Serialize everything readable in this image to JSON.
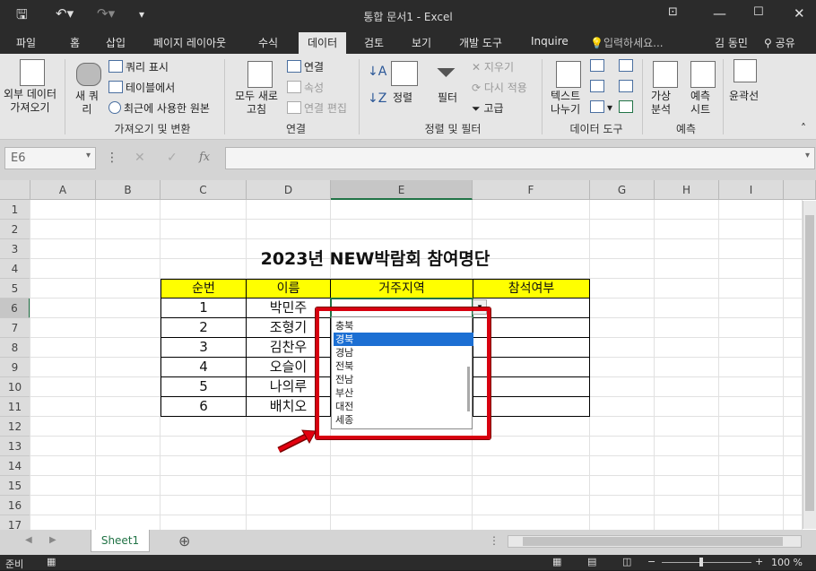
{
  "window": {
    "title": "통합 문서1 - Excel",
    "qat_icons": [
      "save-icon",
      "undo-icon",
      "redo-icon",
      "customize-icon"
    ],
    "controls": [
      "ribbon-display-icon",
      "minimize-icon",
      "maximize-icon",
      "close-icon"
    ]
  },
  "tabs": [
    "파일",
    "홈",
    "삽입",
    "페이지 레이아웃",
    "수식",
    "데이터",
    "검토",
    "보기",
    "개발 도구",
    "Inquire"
  ],
  "active_tab": "데이터",
  "tell_me": "입력하세요...",
  "user": "김 동민",
  "share": "공유",
  "ribbon": {
    "external_data": "외부 데이터\n가져오기",
    "new_query": "새 쿼\n리",
    "show_query": "쿼리 표시",
    "from_table": "테이블에서",
    "recent_sources": "최근에 사용한 원본",
    "refresh_all": "모두 새로\n고침",
    "connections": "연결",
    "properties": "속성",
    "edit_links": "연결 편집",
    "sort": "정렬",
    "filter": "필터",
    "clear": "지우기",
    "reapply": "다시 적용",
    "advanced": "고급",
    "text_to_columns": "텍스트\n나누기",
    "what_if": "가상\n분석",
    "forecast_sheet": "예측\n시트",
    "outline": "윤곽선",
    "groups": {
      "get_transform": "가져오기 및 변환",
      "connections": "연결",
      "sort_filter": "정렬 및 필터",
      "data_tools": "데이터 도구",
      "forecast": "예측"
    }
  },
  "formula_bar": {
    "name_box": "E6",
    "fx": "fx",
    "value": ""
  },
  "columns": [
    "A",
    "B",
    "C",
    "D",
    "E",
    "F",
    "G",
    "H",
    "I"
  ],
  "rows": [
    "1",
    "2",
    "3",
    "4",
    "5",
    "6",
    "7",
    "8",
    "9",
    "10",
    "11",
    "12",
    "13",
    "14",
    "15",
    "16",
    "17"
  ],
  "sheet": {
    "title": "2023년 NEW박람회 참여명단",
    "headers": [
      "순번",
      "이름",
      "거주지역",
      "참석여부"
    ],
    "data": [
      [
        "1",
        "박민주"
      ],
      [
        "2",
        "조형기"
      ],
      [
        "3",
        "김찬우"
      ],
      [
        "4",
        "오슬이"
      ],
      [
        "5",
        "나의루"
      ],
      [
        "6",
        "배치오"
      ]
    ]
  },
  "dropdown": {
    "items": [
      "충북",
      "경북",
      "경남",
      "전북",
      "전남",
      "부산",
      "대전",
      "세종"
    ],
    "selected": "경북"
  },
  "sheet_tab": "Sheet1",
  "status": {
    "ready": "준비",
    "zoom": "100 %"
  }
}
